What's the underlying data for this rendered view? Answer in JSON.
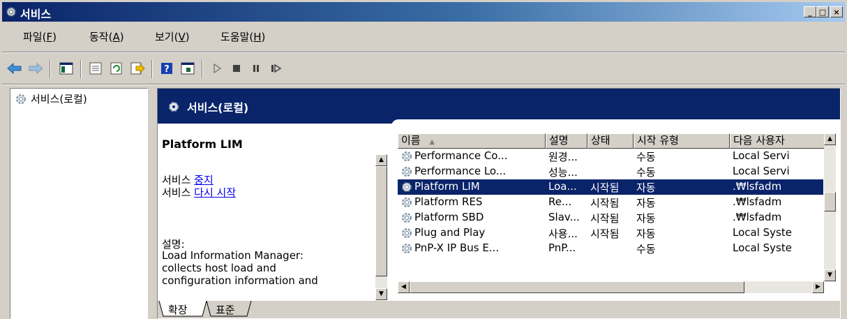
{
  "window": {
    "title": "서비스",
    "buttons": {
      "minimize": "_",
      "maximize": "□",
      "close": "×"
    }
  },
  "menu": [
    {
      "label": "파일(",
      "key": "F",
      "end": ")"
    },
    {
      "label": "동작(",
      "key": "A",
      "end": ")"
    },
    {
      "label": "보기(",
      "key": "V",
      "end": ")"
    },
    {
      "label": "도움말(",
      "key": "H",
      "end": ")"
    }
  ],
  "toolbar": {
    "icons": [
      "back-icon",
      "forward-icon",
      "show-hide-tree-icon",
      "properties-icon",
      "refresh-icon",
      "export-list-icon",
      "help-icon",
      "console-icon",
      "start-service-icon",
      "stop-service-icon",
      "pause-service-icon",
      "resume-service-icon"
    ]
  },
  "tree": {
    "item": "서비스(로컬)"
  },
  "header": {
    "title": "서비스(로컬)"
  },
  "details": {
    "service_name": "Platform LIM",
    "stop_prefix": "서비스 ",
    "stop_link": "중지",
    "restart_prefix": "서비스 ",
    "restart_link": "다시 시작",
    "desc_label": "설명:",
    "desc_lines": [
      "Load Information Manager:",
      "collects host load and",
      "configuration information and"
    ]
  },
  "list": {
    "columns": [
      "이름",
      "설명",
      "상태",
      "시작 유형",
      "다음 사용자"
    ],
    "sort_indicator": "▲",
    "rows": [
      {
        "name": "Performance Co...",
        "desc": "원경...",
        "status": "",
        "startup": "수동",
        "logon": "Local Servi"
      },
      {
        "name": "Performance Lo...",
        "desc": "성능...",
        "status": "",
        "startup": "수동",
        "logon": "Local Servi"
      },
      {
        "name": "Platform LIM",
        "desc": "Loa...",
        "status": "시작됨",
        "startup": "자동",
        "logon": ".₩lsfadm",
        "selected": true
      },
      {
        "name": "Platform RES",
        "desc": "Re...",
        "status": "시작됨",
        "startup": "자동",
        "logon": ".₩lsfadm"
      },
      {
        "name": "Platform SBD",
        "desc": "Slav...",
        "status": "시작됨",
        "startup": "자동",
        "logon": ".₩lsfadm"
      },
      {
        "name": "Plug and Play",
        "desc": "사용...",
        "status": "시작됨",
        "startup": "자동",
        "logon": "Local Syste"
      },
      {
        "name": "PnP-X IP Bus E...",
        "desc": "PnP...",
        "status": "",
        "startup": "수동",
        "logon": "Local Syste"
      }
    ]
  },
  "tabs": [
    "확장",
    "표준"
  ],
  "colors": {
    "selection": "#0a246a",
    "header_blue": "#0a246a",
    "link": "#0000ee"
  }
}
